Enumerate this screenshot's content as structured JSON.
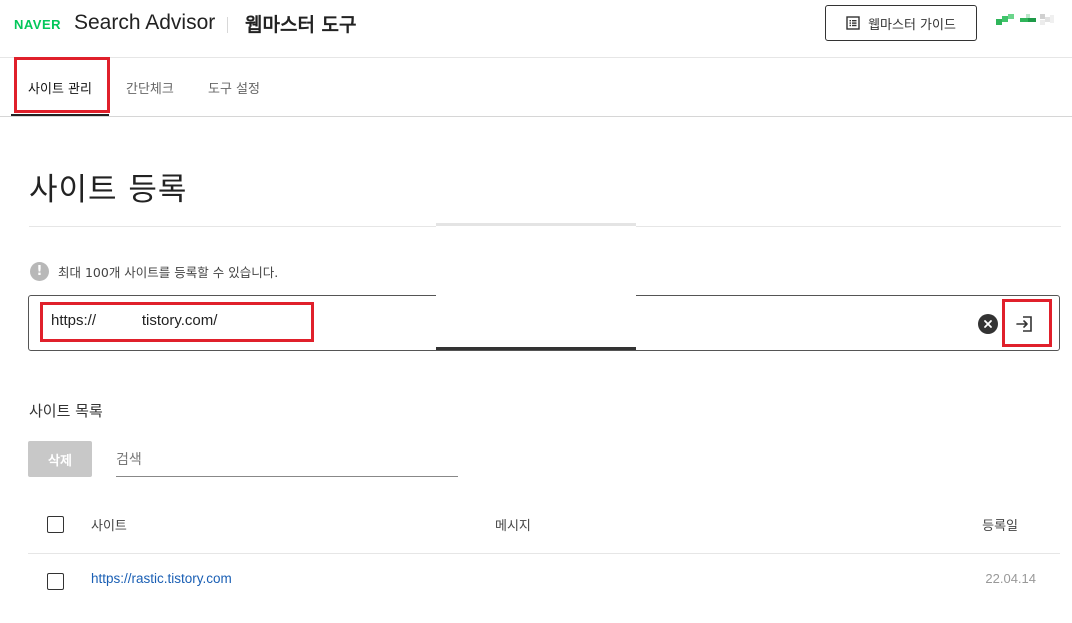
{
  "header": {
    "logo": "NAVER",
    "title": "Search Advisor",
    "subtitle": "웹마스터 도구",
    "guide_button": "웹마스터 가이드",
    "guide_icon": "document-list-icon",
    "avatar_icon": "pixelated-avatar-icon"
  },
  "tabs": [
    {
      "label": "사이트 관리",
      "active": true
    },
    {
      "label": "간단체크",
      "active": false
    },
    {
      "label": "도구 설정",
      "active": false
    }
  ],
  "main": {
    "title": "사이트 등록",
    "info_icon": "info-circle-icon",
    "info_text": "최대 100개 사이트를 등록할 수 있습니다.",
    "url_input": {
      "value": "https://           tistory.com/",
      "clear_icon": "clear-x-icon",
      "submit_icon": "login-arrow-icon"
    }
  },
  "site_list": {
    "title": "사이트 목록",
    "delete_button": "삭제",
    "search_placeholder": "검색",
    "columns": [
      "사이트",
      "메시지",
      "등록일"
    ],
    "rows": [
      {
        "site": "https://rastic.tistory.com",
        "message": "",
        "date": "22.04.14"
      }
    ]
  },
  "colors": {
    "brand_green": "#03c75a",
    "highlight_red": "#e0202b",
    "link_blue": "#1a5fb4"
  }
}
